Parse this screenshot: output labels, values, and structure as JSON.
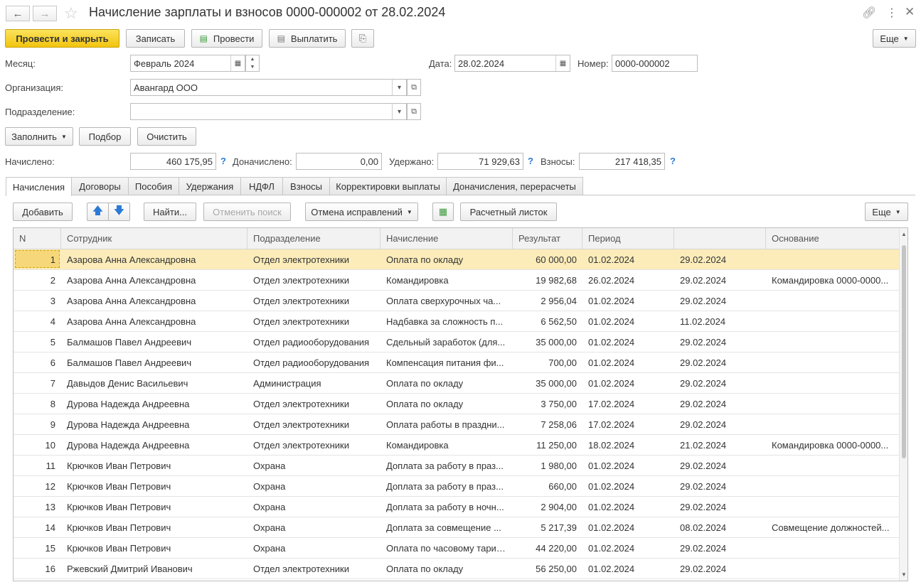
{
  "header": {
    "title": "Начисление зарплаты и взносов 0000-000002 от 28.02.2024",
    "back_icon": "arrow-left-icon",
    "forward_icon": "arrow-right-icon",
    "star_icon": "star-icon",
    "link_icon": "link-icon",
    "menu_icon": "more-vertical-icon",
    "close_icon": "close-icon"
  },
  "toolbar": {
    "post_close": "Провести и закрыть",
    "save": "Записать",
    "post": "Провести",
    "pay": "Выплатить",
    "more": "Еще"
  },
  "form": {
    "month_label": "Месяц:",
    "month_value": "Февраль 2024",
    "date_label": "Дата:",
    "date_value": "28.02.2024",
    "number_label": "Номер:",
    "number_value": "0000-000002",
    "org_label": "Организация:",
    "org_value": "Авангард ООО",
    "dept_label": "Подразделение:",
    "dept_value": ""
  },
  "actions": {
    "fill": "Заполнить",
    "select": "Подбор",
    "clear": "Очистить"
  },
  "totals": {
    "accrued_label": "Начислено:",
    "accrued_value": "460 175,95",
    "extra_label": "Доначислено:",
    "extra_value": "0,00",
    "withheld_label": "Удержано:",
    "withheld_value": "71 929,63",
    "contrib_label": "Взносы:",
    "contrib_value": "217 418,35",
    "help": "?"
  },
  "tabs": [
    "Начисления",
    "Договоры",
    "Пособия",
    "Удержания",
    "НДФЛ",
    "Взносы",
    "Корректировки выплаты",
    "Доначисления, перерасчеты"
  ],
  "table_toolbar": {
    "add": "Добавить",
    "find": "Найти...",
    "cancel_search": "Отменить поиск",
    "cancel_fix": "Отмена исправлений",
    "payslip": "Расчетный листок",
    "more": "Еще"
  },
  "table": {
    "columns": [
      "N",
      "Сотрудник",
      "Подразделение",
      "Начисление",
      "Результат",
      "Период",
      "",
      "Основание"
    ],
    "rows": [
      [
        "1",
        "Азарова Анна Александровна",
        "Отдел электротехники",
        "Оплата по окладу",
        "60 000,00",
        "01.02.2024",
        "29.02.2024",
        ""
      ],
      [
        "2",
        "Азарова Анна Александровна",
        "Отдел электротехники",
        "Командировка",
        "19 982,68",
        "26.02.2024",
        "29.02.2024",
        "Командировка 0000-0000..."
      ],
      [
        "3",
        "Азарова Анна Александровна",
        "Отдел электротехники",
        "Оплата сверхурочных ча...",
        "2 956,04",
        "01.02.2024",
        "29.02.2024",
        ""
      ],
      [
        "4",
        "Азарова Анна Александровна",
        "Отдел электротехники",
        "Надбавка за сложность п...",
        "6 562,50",
        "01.02.2024",
        "11.02.2024",
        ""
      ],
      [
        "5",
        "Балмашов Павел Андреевич",
        "Отдел радиооборудования",
        "Сдельный заработок (для...",
        "35 000,00",
        "01.02.2024",
        "29.02.2024",
        ""
      ],
      [
        "6",
        "Балмашов Павел Андреевич",
        "Отдел радиооборудования",
        "Компенсация питания фи...",
        "700,00",
        "01.02.2024",
        "29.02.2024",
        ""
      ],
      [
        "7",
        "Давыдов Денис Васильевич",
        "Администрация",
        "Оплата по окладу",
        "35 000,00",
        "01.02.2024",
        "29.02.2024",
        ""
      ],
      [
        "8",
        "Дурова Надежда Андреевна",
        "Отдел электротехники",
        "Оплата по окладу",
        "3 750,00",
        "17.02.2024",
        "29.02.2024",
        ""
      ],
      [
        "9",
        "Дурова Надежда Андреевна",
        "Отдел электротехники",
        "Оплата работы в праздни...",
        "7 258,06",
        "17.02.2024",
        "29.02.2024",
        ""
      ],
      [
        "10",
        "Дурова Надежда Андреевна",
        "Отдел электротехники",
        "Командировка",
        "11 250,00",
        "18.02.2024",
        "21.02.2024",
        "Командировка 0000-0000..."
      ],
      [
        "11",
        "Крючков Иван Петрович",
        "Охрана",
        "Доплата за работу в праз...",
        "1 980,00",
        "01.02.2024",
        "29.02.2024",
        ""
      ],
      [
        "12",
        "Крючков Иван Петрович",
        "Охрана",
        "Доплата за работу в праз...",
        "660,00",
        "01.02.2024",
        "29.02.2024",
        ""
      ],
      [
        "13",
        "Крючков Иван Петрович",
        "Охрана",
        "Доплата за работу в ночн...",
        "2 904,00",
        "01.02.2024",
        "29.02.2024",
        ""
      ],
      [
        "14",
        "Крючков Иван Петрович",
        "Охрана",
        "Доплата за совмещение ...",
        "5 217,39",
        "01.02.2024",
        "08.02.2024",
        "Совмещение должностей..."
      ],
      [
        "15",
        "Крючков Иван Петрович",
        "Охрана",
        "Оплата по часовому тарифу",
        "44 220,00",
        "01.02.2024",
        "29.02.2024",
        ""
      ],
      [
        "16",
        "Ржевский Дмитрий Иванович",
        "Отдел электротехники",
        "Оплата по окладу",
        "56 250,00",
        "01.02.2024",
        "29.02.2024",
        ""
      ]
    ]
  },
  "colors": {
    "primary": "#f2c40f",
    "selected_row": "#fbecba",
    "help": "#2b7bd6"
  }
}
